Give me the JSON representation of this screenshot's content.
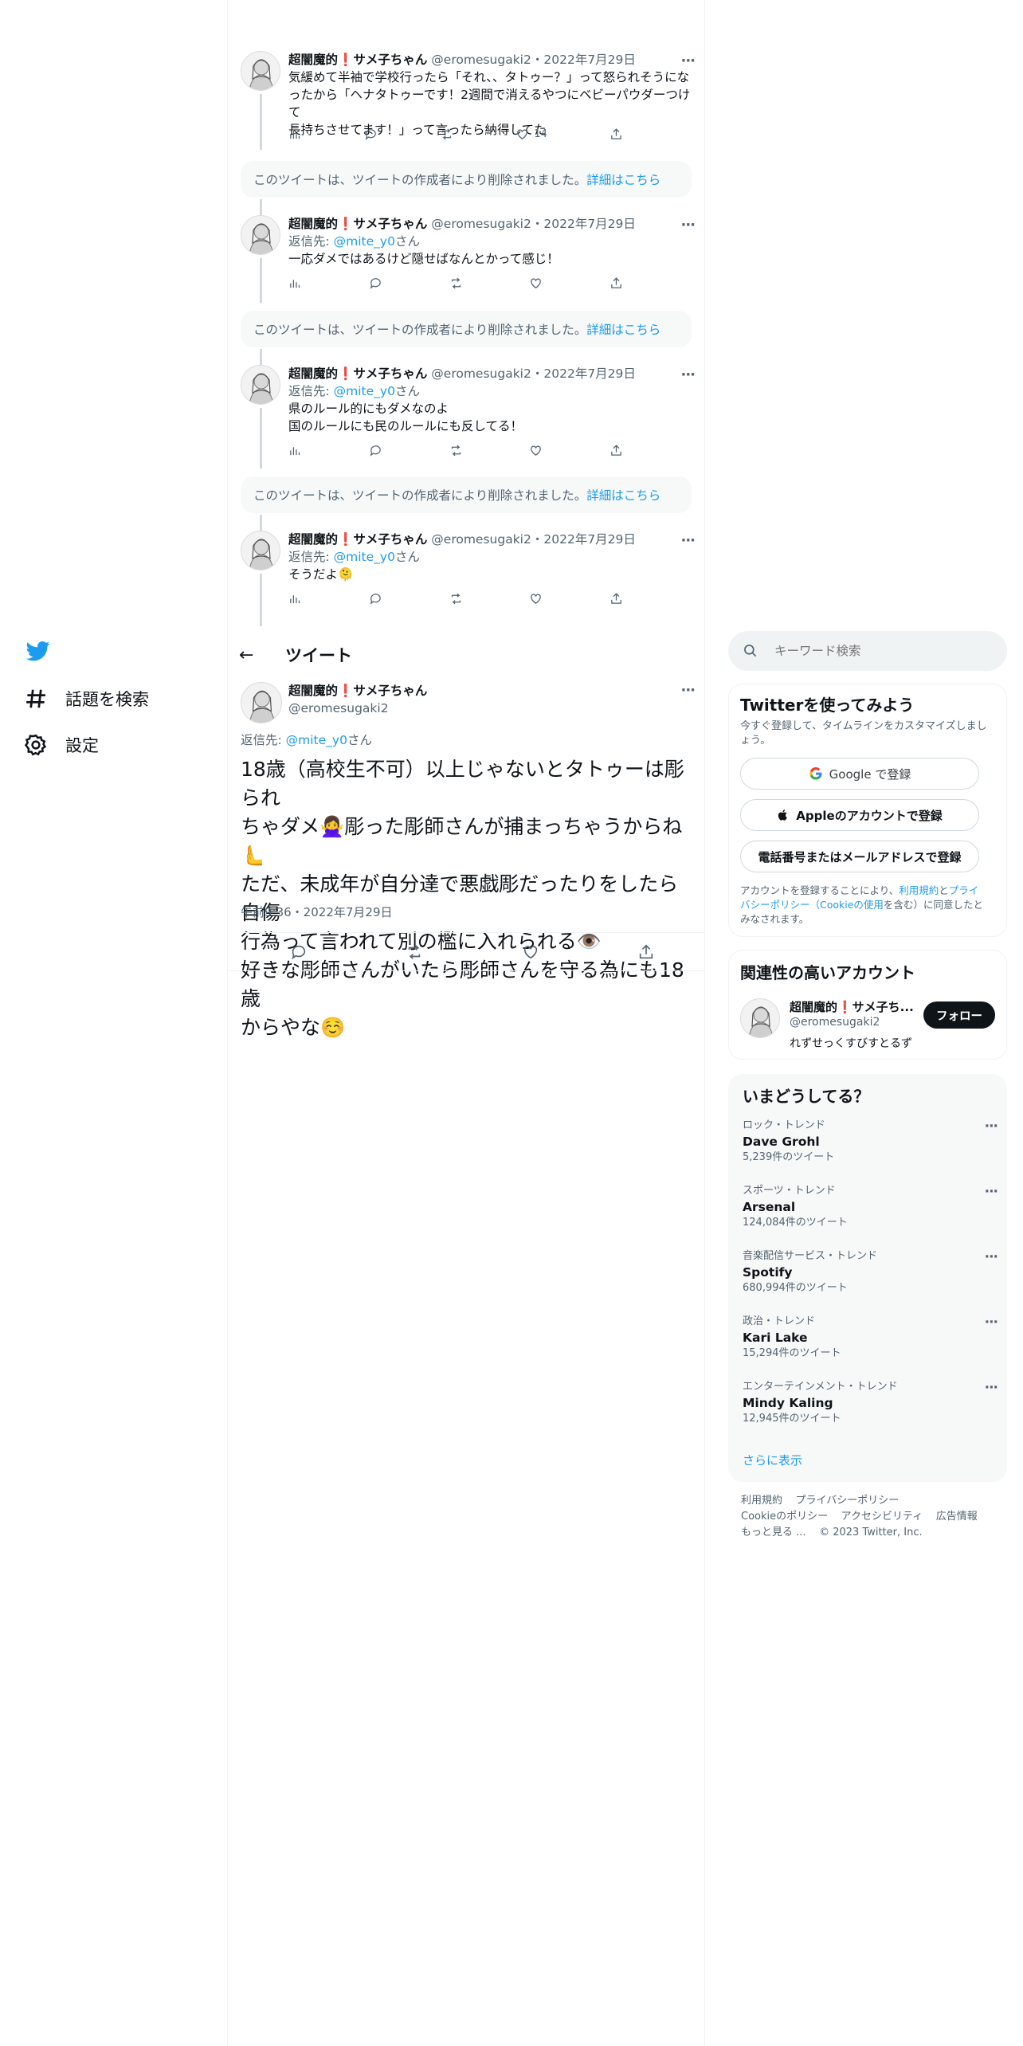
{
  "nav": {
    "logo": "twitter-bird-icon",
    "explore_label": "話題を検索",
    "settings_label": "設定"
  },
  "author": {
    "name_prefix": "超闇魔的",
    "name_mark": "❗",
    "name_suffix": "サメ子ちゃん",
    "handle": "@eromesugaki2",
    "sep": "・"
  },
  "thread": [
    {
      "date": "2022年7月29日",
      "reply_to": "",
      "lines": [
        "気緩めて半袖で学校行ったら「それ、、タトゥー？」って怒られそうにな",
        "ったから「ヘナタトゥーです！2週間で消えるやつにベビーパウダーつけて",
        "長持ちさせてます！」って言ったら納得してた"
      ],
      "likes": "14"
    },
    {
      "date": "2022年7月29日",
      "reply_prefix": "返信先: ",
      "reply_to": "@mite_y0",
      "reply_suffix": "さん",
      "lines": [
        "一応ダメではあるけど隠せばなんとかって感じ！"
      ],
      "likes": ""
    },
    {
      "date": "2022年7月29日",
      "reply_prefix": "返信先: ",
      "reply_to": "@mite_y0",
      "reply_suffix": "さん",
      "lines": [
        "県のルール的にもダメなのよ",
        "国のルールにも民のルールにも反してる！"
      ],
      "likes": ""
    },
    {
      "date": "2022年7月29日",
      "reply_prefix": "返信先: ",
      "reply_to": "@mite_y0",
      "reply_suffix": "さん",
      "lines": [
        "そうだよ🫠"
      ],
      "likes": ""
    }
  ],
  "deleted_notice": {
    "text": "このツイートは、ツイートの作成者により削除されました。",
    "link": "詳細はこちら"
  },
  "header": {
    "back": "←",
    "title": "ツイート"
  },
  "main_tweet": {
    "reply_prefix": "返信先: ",
    "reply_to": "@mite_y0",
    "reply_suffix": "さん",
    "lines": [
      "18歳（高校生不可）以上じゃないとタトゥーは彫られ",
      "ちゃダメ🙅‍♀️彫った彫師さんが捕まっちゃうからね🫷",
      "ただ、未成年が自分達で悪戯彫だったりをしたら自傷",
      "行為って言われて別の檻に入れられる👁️",
      "好きな彫師さんがいたら彫師さんを守る為にも18歳",
      "からやな☺️"
    ],
    "timestamp": "午前9:36・2022年7月29日"
  },
  "search": {
    "placeholder": "キーワード検索"
  },
  "signup": {
    "title": "Twitterを使ってみよう",
    "subtitle_l1": "今すぐ登録して、タイムラインをカスタマイズしまし",
    "subtitle_l2": "ょう。",
    "google_btn": "Google で登録",
    "apple_btn": "Appleのアカウントで登録",
    "phone_btn": "電話番号またはメールアドレスで登録",
    "terms_a": "アカウントを登録することにより、",
    "terms_link1": "利用規約",
    "terms_b": "と",
    "terms_link2": "プライ",
    "terms_link3": "バシーポリシー（Cookieの使用",
    "terms_c": "を含む）に同意したと",
    "terms_d": "みなされます。"
  },
  "related": {
    "title": "関連性の高いアカウント",
    "name": "超闇魔的❗サメ子ち...",
    "handle": "@eromesugaki2",
    "bio": "れずせっくすびすとるず",
    "follow": "フォロー"
  },
  "trends": {
    "title": "いまどうしてる？",
    "items": [
      {
        "category": "ロック・トレンド",
        "name": "Dave Grohl",
        "count": "5,239件のツイート"
      },
      {
        "category": "スポーツ・トレンド",
        "name": "Arsenal",
        "count": "124,084件のツイート"
      },
      {
        "category": "音楽配信サービス・トレンド",
        "name": "Spotify",
        "count": "680,994件のツイート"
      },
      {
        "category": "政治・トレンド",
        "name": "Kari Lake",
        "count": "15,294件のツイート"
      },
      {
        "category": "エンターテインメント・トレンド",
        "name": "Mindy Kaling",
        "count": "12,945件のツイート"
      }
    ],
    "show_more": "さらに表示"
  },
  "footer": {
    "terms": "利用規約",
    "privacy": "プライバシーポリシー",
    "cookie": "Cookieのポリシー",
    "accessibility": "アクセシビリティ",
    "ads": "広告情報",
    "more": "もっと見る ...",
    "copyright": "© 2023 Twitter, Inc."
  },
  "colors": {
    "accent": "#1d9bf0",
    "text": "#0f1419",
    "muted": "#536471"
  }
}
